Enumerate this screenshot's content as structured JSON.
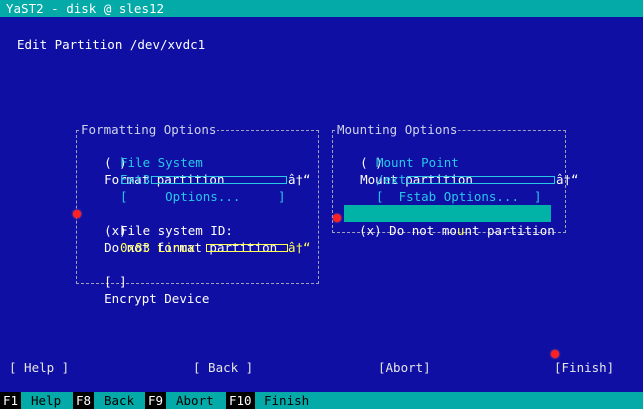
{
  "window": {
    "title": "YaST2 - disk @ sles12"
  },
  "dialog": {
    "title": "Edit Partition /dev/xvdc1"
  },
  "formatting": {
    "frame_title": "Formatting Options",
    "format_partition": {
      "mark": "( )",
      "label": "Format partition"
    },
    "file_system_label": "File System",
    "file_system_value": "Ext3",
    "file_system_arrow": "â†“",
    "options_button": "[     Options...     ]",
    "do_not_format": {
      "mark": "(x)",
      "label": "Do not format partition"
    },
    "fs_id_label": "File system ID:",
    "fs_id_value": "0x83 Linux",
    "fs_id_arrow": "â†“",
    "encrypt": {
      "mark": "[ ]",
      "label": "Encrypt Device"
    }
  },
  "mounting": {
    "frame_title": "Mounting Options",
    "mount_partition": {
      "mark": "( )",
      "label": "Mount partition"
    },
    "mount_point_label": "Mount Point",
    "mount_point_value": "/ext",
    "mount_point_arrow": "â†“",
    "fstab_button": "[  Fstab Options...  ]",
    "do_not_mount": {
      "mark": "(x)",
      "label_a": "Do not mo",
      "hotkey": "u",
      "label_b": "nt partition"
    }
  },
  "buttons": {
    "help": "[ Help ]",
    "back": "[ Back ]",
    "abort": "[Abort]",
    "finish": "[Finish]"
  },
  "fkeys": [
    {
      "key": "F1",
      "label": "Help"
    },
    {
      "key": "F8",
      "label": "Back"
    },
    {
      "key": "F9",
      "label": "Abort"
    },
    {
      "key": "F10",
      "label": "Finish"
    }
  ],
  "colors": {
    "background": "#0f0fa3",
    "bar": "#04aaa8",
    "highlight": "#00b3a6",
    "hotkey": "#ffff54",
    "label_cyan": "#29c7e8",
    "marker_red": "#ff2020"
  }
}
